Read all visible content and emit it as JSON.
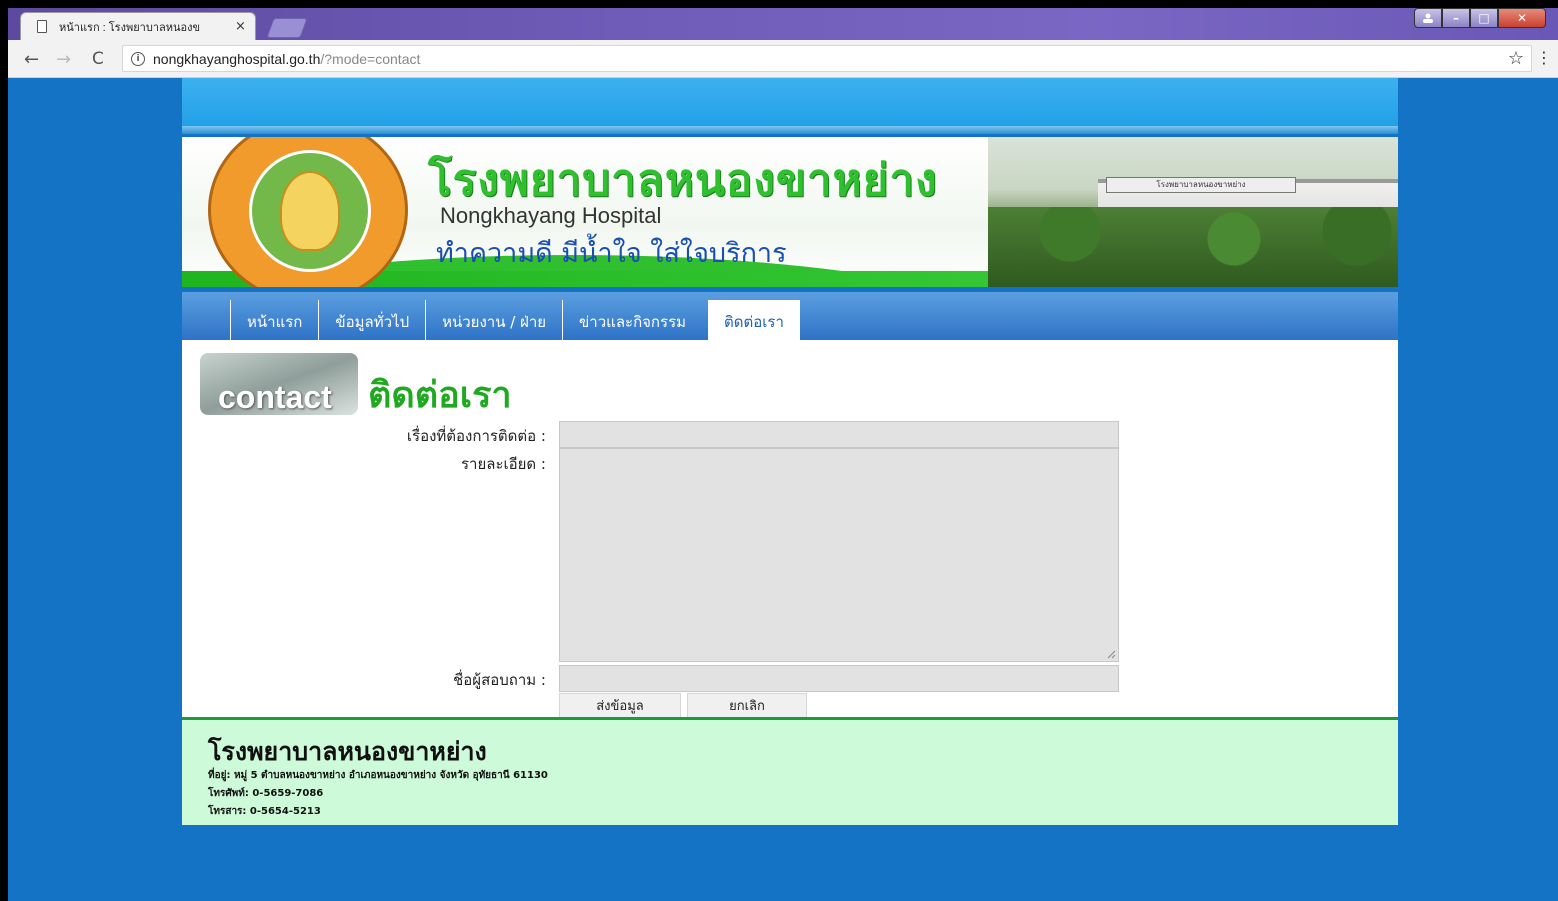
{
  "browser": {
    "tab_title": "หน้าแรก : โรงพยาบาลหนองข",
    "tab_close": "×",
    "url_host": "nongkhayanghospital.go.th",
    "url_path": "/?mode=contact",
    "back": "←",
    "forward": "→",
    "reload": "C",
    "star": "☆",
    "menu": "⋮",
    "info": "i",
    "win_min": "–",
    "win_max": "□",
    "win_close": "✕"
  },
  "header": {
    "title": "โรงพยาบาลหนองขาหย่าง",
    "subtitle": "Nongkhayang Hospital",
    "motto": "ทำความดี มีน้ำใจ ใส่ใจบริการ",
    "photo_sign": "โรงพยาบาลหนองขาหย่าง"
  },
  "nav": {
    "items": [
      {
        "label": "หน้าแรก"
      },
      {
        "label": "ข้อมูลทั่วไป"
      },
      {
        "label": "หน่วยงาน / ฝ่าย"
      },
      {
        "label": "ข่าวและกิจกรรม"
      },
      {
        "label": "ติดต่อเรา",
        "active": true
      }
    ]
  },
  "contact": {
    "badge_text": "contact",
    "heading": "ติดต่อเรา",
    "subject_label": "เรื่องที่ต้องการติดต่อ :",
    "detail_label": "รายละเอียด :",
    "name_label": "ชื่อผู้สอบถาม :",
    "submit_label": "ส่งข้อมูล",
    "cancel_label": "ยกเลิก"
  },
  "footer": {
    "title": "โรงพยาบาลหนองขาหย่าง",
    "address": "ที่อยู่:   หมู่ 5 ตำบลหนองขาหย่าง อำเภอหนองขาหย่าง จังหวัด อุทัยธานี 61130",
    "phone": "โทรศัพท์: 0-5659-7086",
    "fax": "โทรสาร: 0-5654-5213"
  },
  "colors": {
    "page_background": "#1573c6",
    "nav_blue": "#2e73c7",
    "brand_green": "#2fbf2f",
    "footer_bg": "#cdfad8"
  }
}
